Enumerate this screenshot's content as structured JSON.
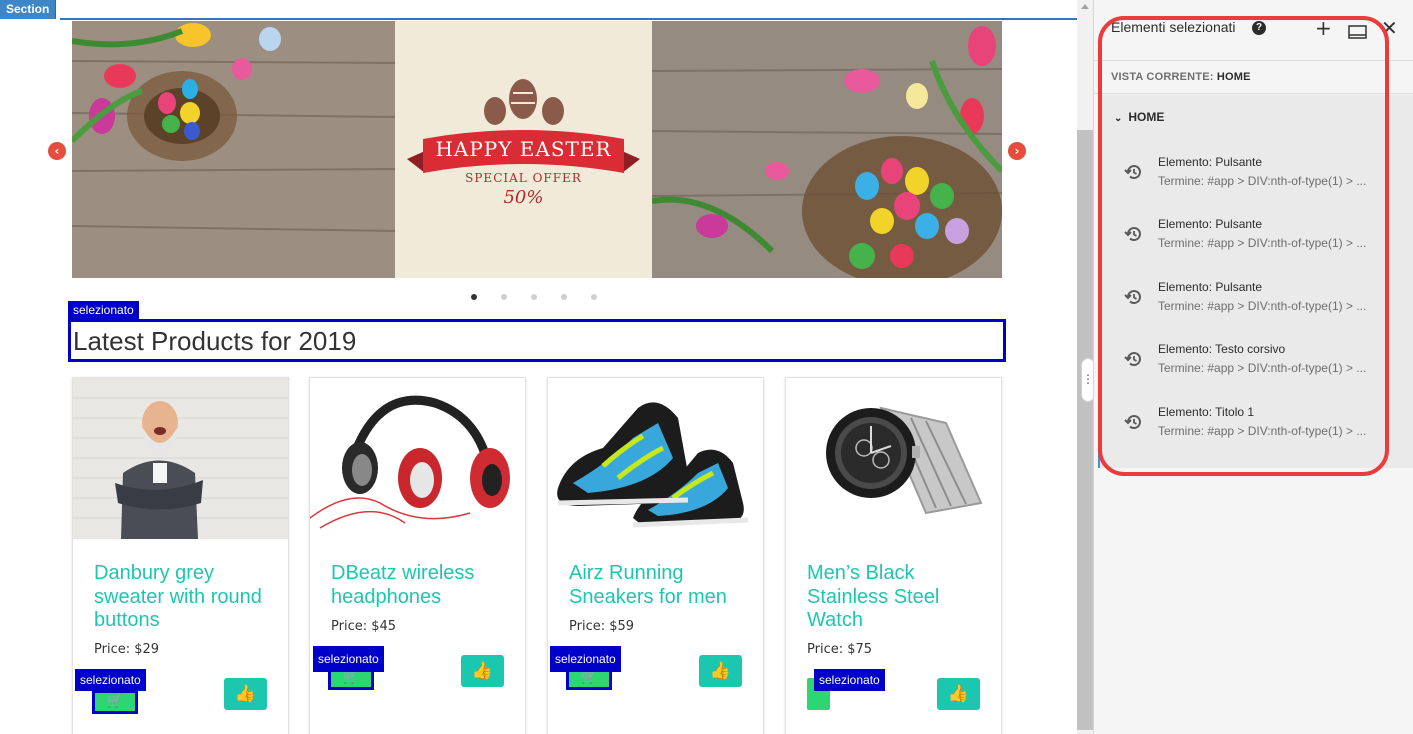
{
  "canvas": {
    "section_tag": "Section",
    "heading": "Latest Products for 2019",
    "selected_label": "selezionato",
    "carousel": {
      "banner_text": "HAPPY EASTER",
      "offer_text": "SPECIAL OFFER",
      "discount_text": "50%",
      "slide_count": 5,
      "active_slide": 1
    },
    "products": [
      {
        "title": "Danbury grey sweater with round buttons",
        "price": "Price: $29",
        "image": "man-in-sweater-photo"
      },
      {
        "title": "DBeatz wireless headphones",
        "price": "Price: $45",
        "image": "headphones-photo"
      },
      {
        "title": "Airz Running Sneakers for men",
        "price": "Price: $59",
        "image": "sneakers-photo"
      },
      {
        "title": "Men’s Black Stainless Steel Watch",
        "price": "Price: $75",
        "image": "watch-photo"
      }
    ]
  },
  "panel": {
    "title": "Elementi selezionati",
    "vista_label": "VISTA CORRENTE:",
    "vista_value": "HOME",
    "group_label": "HOME",
    "items": [
      {
        "name": "Elemento: Pulsante",
        "term": "Termine: #app > DIV:nth-of-type(1) > ..."
      },
      {
        "name": "Elemento: Pulsante",
        "term": "Termine: #app > DIV:nth-of-type(1) > ..."
      },
      {
        "name": "Elemento: Pulsante",
        "term": "Termine: #app > DIV:nth-of-type(1) > ..."
      },
      {
        "name": "Elemento: Testo corsivo",
        "term": "Termine: #app > DIV:nth-of-type(1) > ..."
      },
      {
        "name": "Elemento: Titolo 1",
        "term": "Termine: #app > DIV:nth-of-type(1) > ..."
      }
    ],
    "icons": [
      "help-icon",
      "add-icon",
      "panel-layout-icon",
      "close-icon",
      "history-icon",
      "chevron-down-icon"
    ]
  },
  "colors": {
    "accent_teal": "#1cc7b0",
    "selection_blue": "#0000c8",
    "highlight_red": "#ea3c3c",
    "section_blue": "#3f86c8"
  }
}
